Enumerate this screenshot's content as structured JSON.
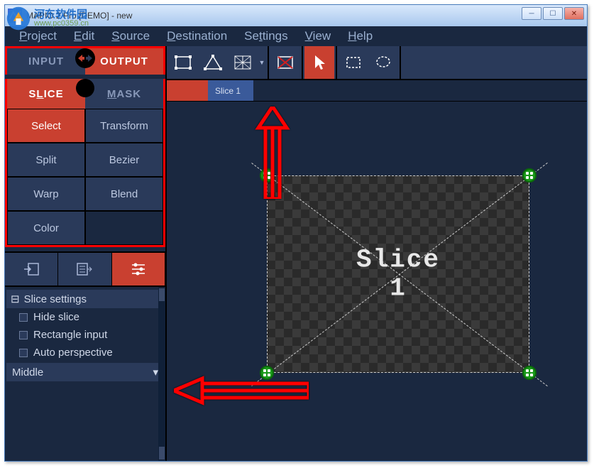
{
  "window": {
    "title": "MAPIO 2 Pro [DEMO] - new",
    "watermark_cn": "河东软件园",
    "watermark_url": "www.pc0359.cn"
  },
  "menubar": [
    "Project",
    "Edit",
    "Source",
    "Destination",
    "Settings",
    "View",
    "Help"
  ],
  "io": {
    "input": "INPUT",
    "output": "OUTPUT"
  },
  "sm": {
    "slice": "SLICE",
    "mask": "MASK"
  },
  "tools": [
    {
      "label": "Select",
      "active": true
    },
    {
      "label": "Transform",
      "active": false
    },
    {
      "label": "Split",
      "active": false
    },
    {
      "label": "Bezier",
      "active": false
    },
    {
      "label": "Warp",
      "active": false
    },
    {
      "label": "Blend",
      "active": false
    },
    {
      "label": "Color",
      "active": false
    }
  ],
  "settings": {
    "header": "Slice settings",
    "items": [
      "Hide slice",
      "Rectangle input",
      "Auto perspective"
    ],
    "dropdown": "Middle"
  },
  "tabs": [
    {
      "label": "Slice 1"
    }
  ],
  "canvas": {
    "label": "Slice\n1"
  }
}
